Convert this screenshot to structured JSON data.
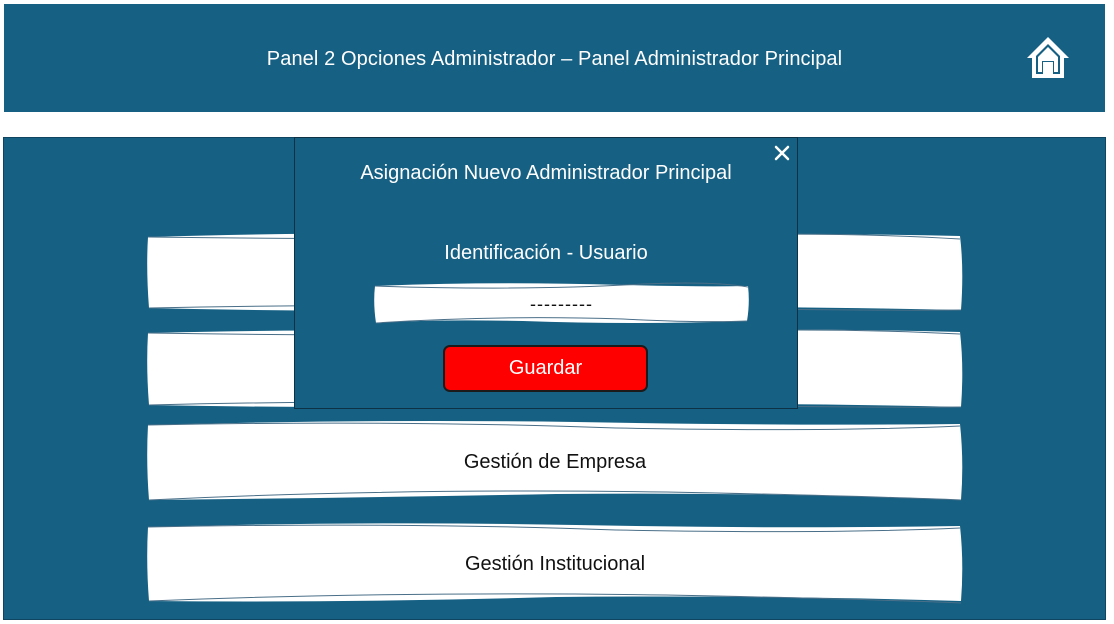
{
  "header": {
    "title": "Panel 2 Opciones Administrador – Panel Administrador Principal",
    "home_icon": "home-icon"
  },
  "menu": {
    "items": [
      {
        "label": ""
      },
      {
        "label": ""
      },
      {
        "label": "Gestión de Empresa"
      },
      {
        "label": "Gestión Institucional"
      }
    ]
  },
  "modal": {
    "title": "Asignación Nuevo Administrador Principal",
    "close_icon": "close-icon",
    "field_label": "Identificación - Usuario",
    "field_value": "---------",
    "save_label": "Guardar"
  },
  "colors": {
    "primary": "#166083",
    "save_button": "#ff0000",
    "text_light": "#ffffff"
  }
}
